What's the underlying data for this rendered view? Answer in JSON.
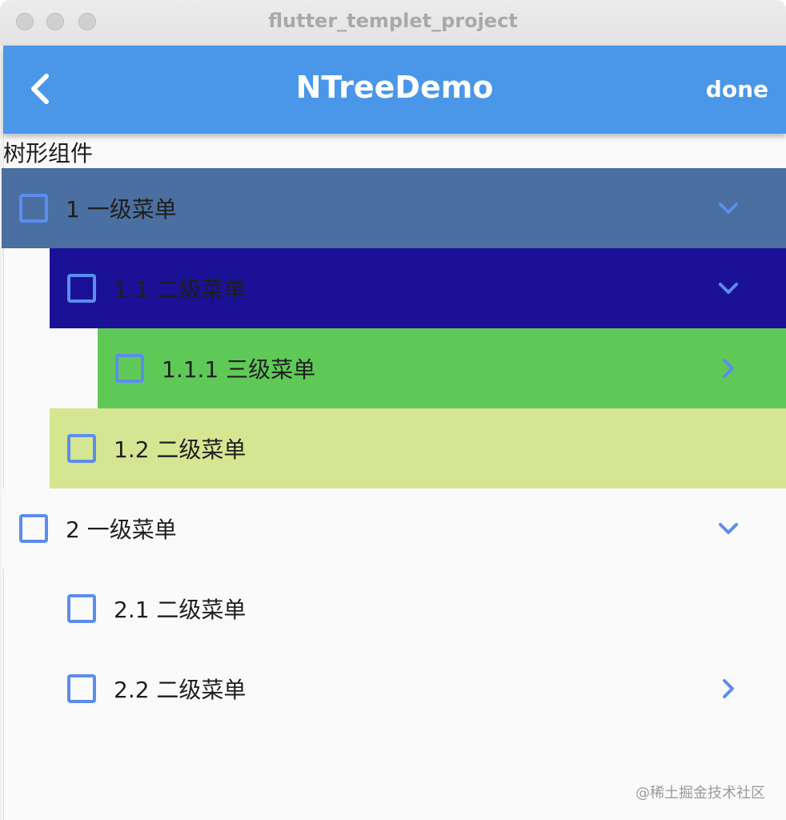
{
  "window": {
    "title": "flutter_templet_project"
  },
  "appbar": {
    "title": "NTreeDemo",
    "done_label": "done",
    "color": "#4a97e9"
  },
  "section_label": "树形组件",
  "tree": {
    "rows": [
      {
        "label": "1 一级菜单",
        "level": 1,
        "expanded": true,
        "checked": false,
        "icon": "chevron-down-icon",
        "background": "#4a6fa0"
      },
      {
        "label": "1.1 二级菜单",
        "level": 2,
        "expanded": true,
        "checked": false,
        "icon": "chevron-down-icon",
        "background": "#1a1196"
      },
      {
        "label": "1.1.1 三级菜单",
        "level": 3,
        "expanded": false,
        "checked": false,
        "icon": "chevron-right-icon",
        "background": "#5fc957"
      },
      {
        "label": "1.2 二级菜单",
        "level": 2,
        "expanded": false,
        "checked": false,
        "icon": "",
        "background": "#d6e592"
      },
      {
        "label": "2 一级菜单",
        "level": 1,
        "expanded": true,
        "checked": false,
        "icon": "chevron-down-icon",
        "background": "#fafafa"
      },
      {
        "label": "2.1 二级菜单",
        "level": 2,
        "expanded": false,
        "checked": false,
        "icon": "",
        "background": "#fafafa"
      },
      {
        "label": "2.2 二级菜单",
        "level": 2,
        "expanded": false,
        "checked": false,
        "icon": "chevron-right-icon",
        "background": "#fafafa"
      }
    ]
  },
  "watermark": "@稀土掘金技术社区",
  "colors": {
    "checkbox": "#5b8def",
    "chevron": "#5b8def"
  }
}
